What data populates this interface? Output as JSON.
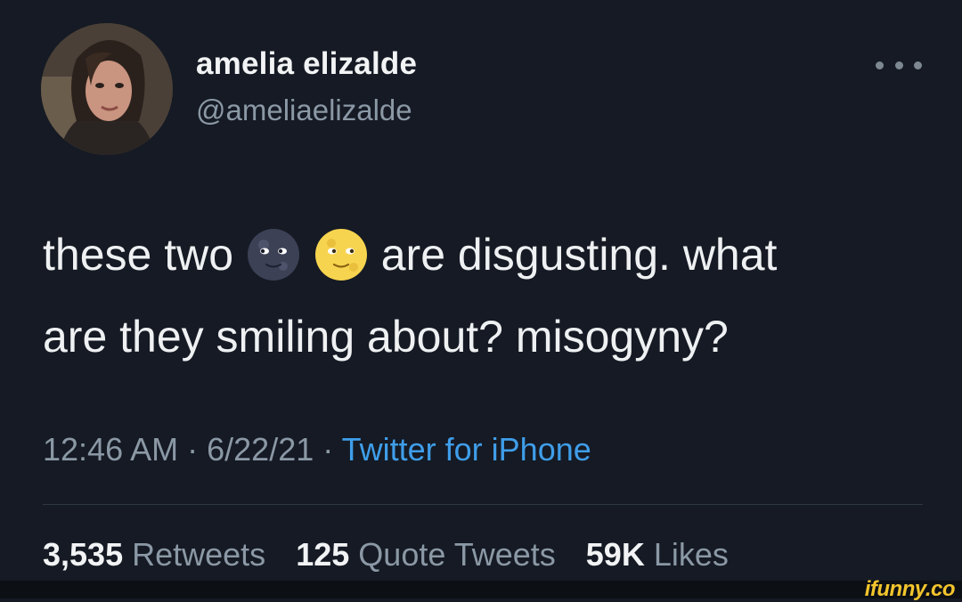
{
  "author": {
    "display_name": "amelia elizalde",
    "handle": "@ameliaelizalde",
    "avatar_icon": "user-photo-avatar"
  },
  "tweet": {
    "text_line1_before": "these two",
    "emoji_1": "new-moon-face-emoji",
    "emoji_2": "full-moon-face-emoji",
    "text_line1_after": "are disgusting. what",
    "text_line2": "are they smiling about? misogyny?"
  },
  "meta": {
    "time": "12:46 AM",
    "separator": "·",
    "date": "6/22/21",
    "source": "Twitter for iPhone"
  },
  "stats": {
    "retweets_count": "3,535",
    "retweets_label": "Retweets",
    "quotes_count": "125",
    "quotes_label": "Quote Tweets",
    "likes_count": "59K",
    "likes_label": "Likes"
  },
  "watermark": "ifunny.co",
  "colors": {
    "background": "#151a24",
    "primary_text": "#eef0f2",
    "secondary_text": "#8b98a5",
    "link": "#3f9ee9",
    "watermark": "#f3c52d"
  }
}
